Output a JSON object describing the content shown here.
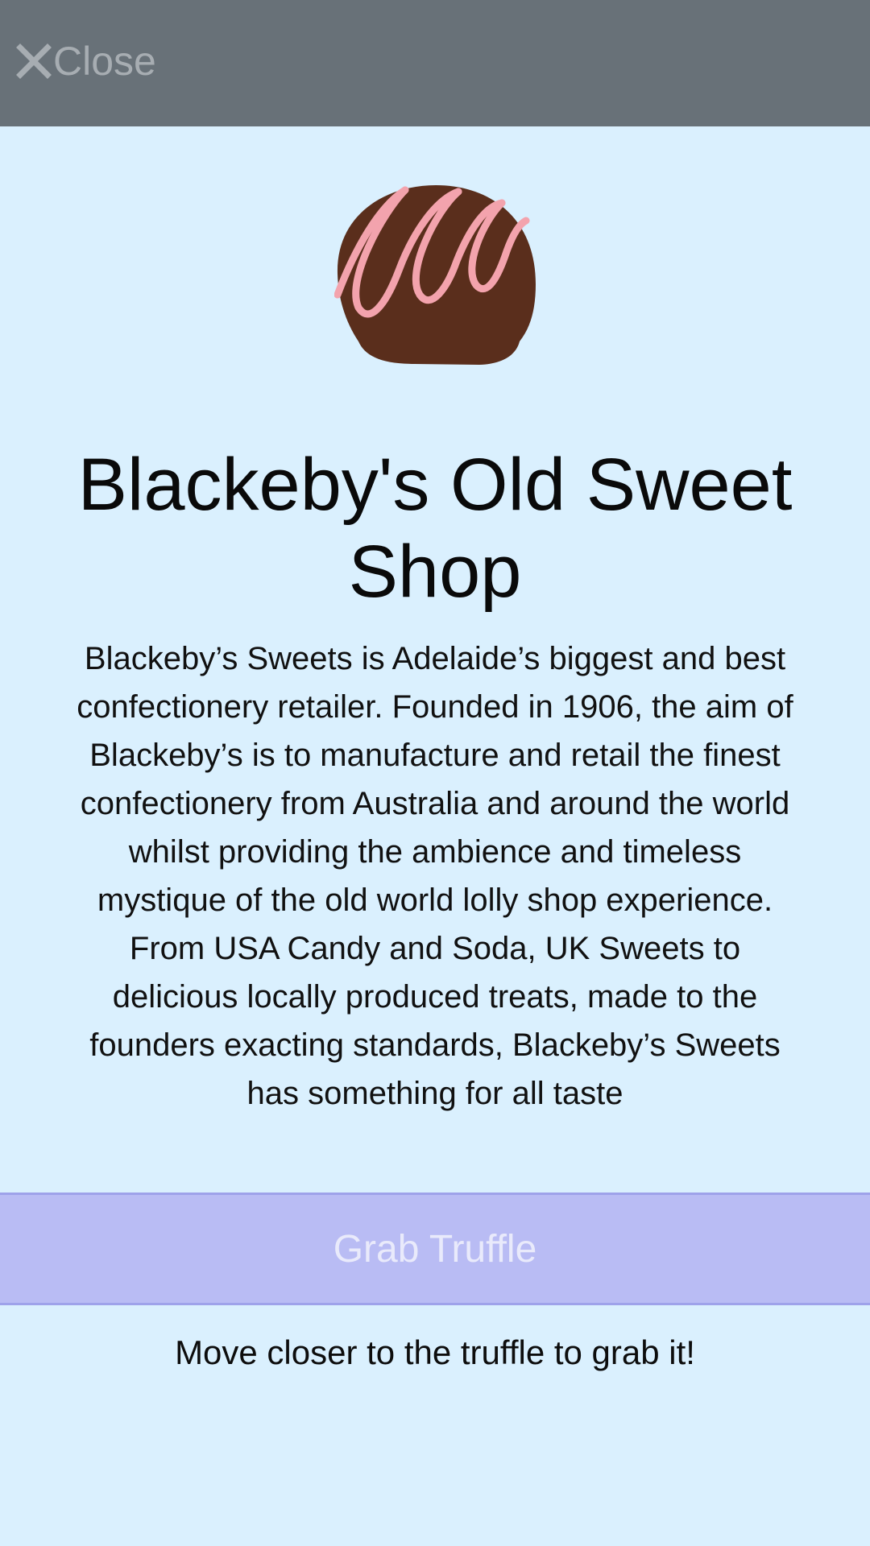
{
  "header": {
    "close_label": "Close",
    "close_icon": "close-icon"
  },
  "shop": {
    "image_icon": "chocolate-truffle-icon",
    "title": "Blackeby's Old Sweet Shop",
    "description": "Blackeby’s Sweets is Adelaide’s biggest and best confectionery retailer. Founded in 1906, the aim of Blackeby’s is to manufacture and retail the finest confectionery from Australia and around the world whilst providing the ambience and timeless mystique of the old world lolly shop experience. From USA Candy and Soda, UK Sweets to delicious locally produced treats, made to the founders exacting standards, Blackeby’s Sweets has something for all taste"
  },
  "action": {
    "button_label": "Grab Truffle",
    "hint": "Move closer to the truffle to grab it!"
  },
  "colors": {
    "background": "#daf0fe",
    "topbar": "#687178",
    "button": "#b9bcf4",
    "chocolate": "#5a2e1c",
    "drizzle": "#f3a3ad"
  }
}
